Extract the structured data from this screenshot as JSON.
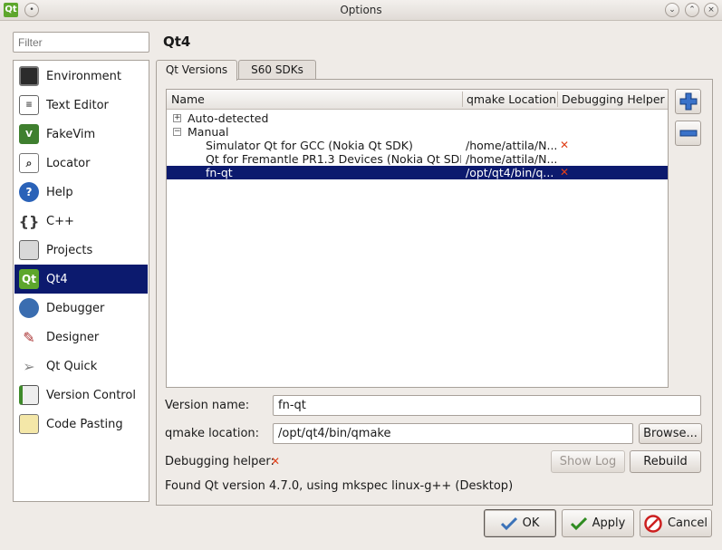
{
  "window": {
    "title": "Options"
  },
  "filter": {
    "placeholder": "Filter"
  },
  "nav": [
    {
      "label": "Environment",
      "icon": "monitor-icon"
    },
    {
      "label": "Text Editor",
      "icon": "text-document-icon"
    },
    {
      "label": "FakeVim",
      "icon": "fakevim-icon"
    },
    {
      "label": "Locator",
      "icon": "locator-magnifier-icon"
    },
    {
      "label": "Help",
      "icon": "help-question-icon"
    },
    {
      "label": "C++",
      "icon": "curly-braces-icon"
    },
    {
      "label": "Projects",
      "icon": "projects-icon"
    },
    {
      "label": "Qt4",
      "icon": "qt-logo-icon",
      "selected": true
    },
    {
      "label": "Debugger",
      "icon": "debugger-bug-icon"
    },
    {
      "label": "Designer",
      "icon": "designer-icon"
    },
    {
      "label": "Qt Quick",
      "icon": "qt-quick-paper-plane-icon"
    },
    {
      "label": "Version Control",
      "icon": "version-control-icon"
    },
    {
      "label": "Code Pasting",
      "icon": "code-pasting-icon"
    }
  ],
  "page": {
    "title": "Qt4",
    "tabs": [
      "Qt Versions",
      "S60 SDKs"
    ],
    "tree": {
      "columns": [
        "Name",
        "qmake Location",
        "Debugging Helper"
      ],
      "groups": [
        {
          "label": "Auto-detected",
          "expander": "+"
        },
        {
          "label": "Manual",
          "expander": "−"
        }
      ],
      "rows": [
        {
          "name": "Simulator Qt for GCC (Nokia Qt SDK)",
          "qmake": "/home/attila/N...",
          "helper": "✕"
        },
        {
          "name": "Qt for Fremantle PR1.3 Devices (Nokia Qt SDK)",
          "qmake": "/home/attila/N...",
          "helper": ""
        },
        {
          "name": "fn-qt",
          "qmake": "/opt/qt4/bin/q...",
          "helper": "✕",
          "selected": true
        }
      ]
    },
    "form": {
      "version_name_label": "Version name:",
      "version_name_value": "fn-qt",
      "qmake_location_label": "qmake location:",
      "qmake_location_value": "/opt/qt4/bin/qmake",
      "browse_label": "Browse...",
      "debugging_helper_label": "Debugging helper:",
      "debugging_helper_status": "✕",
      "show_log_label": "Show Log",
      "rebuild_label": "Rebuild",
      "status_text": "Found Qt version 4.7.0, using mkspec linux-g++ (Desktop)"
    }
  },
  "dialog_buttons": {
    "ok": "OK",
    "apply": "Apply",
    "cancel": "Cancel"
  },
  "colors": {
    "selection": "#0c1a6e",
    "error_mark": "#e0401a",
    "apply_check": "#2e8b20",
    "cancel_red": "#cc1f1f"
  }
}
